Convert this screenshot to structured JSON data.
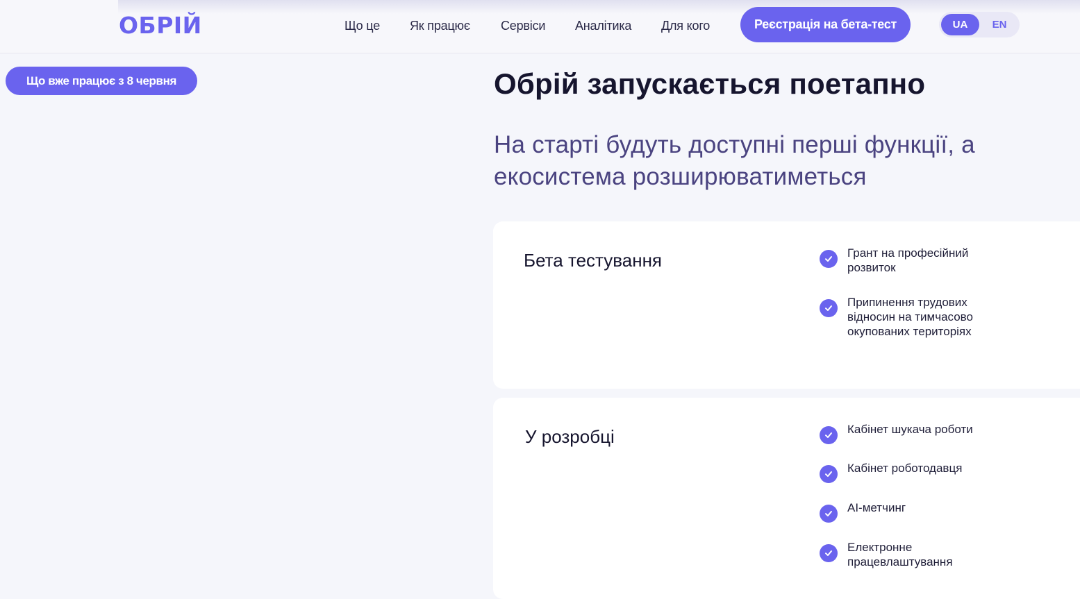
{
  "header": {
    "logo": "ОБРІЙ",
    "nav": [
      "Що це",
      "Як працює",
      "Сервіси",
      "Аналітика",
      "Для кого"
    ],
    "cta_label": "Реєстрація на бета-тест",
    "lang": {
      "active": "UA",
      "inactive": "EN"
    }
  },
  "section": {
    "badge": "Що вже працює з 8 червня",
    "title": "Обрій запускається поетапно",
    "subtitle": "На старті будуть доступні перші функції, а екосистема розширюватиметься"
  },
  "stages": [
    {
      "title": "Бета тестування",
      "features": [
        "Грант на професійний розвиток",
        "Припинення трудових відносин на тимчасово окупованих територіях"
      ]
    },
    {
      "title": "У розробці",
      "features": [
        "Кабінет шукача роботи",
        "Кабінет роботодавця",
        "AI-метчинг",
        "Електронне працевлаштування"
      ]
    }
  ],
  "colors": {
    "accent": "#6a63ee",
    "background": "#f5f6fb",
    "card": "#ffffff"
  },
  "icons": {
    "feature_marker": "check-circle-icon"
  }
}
